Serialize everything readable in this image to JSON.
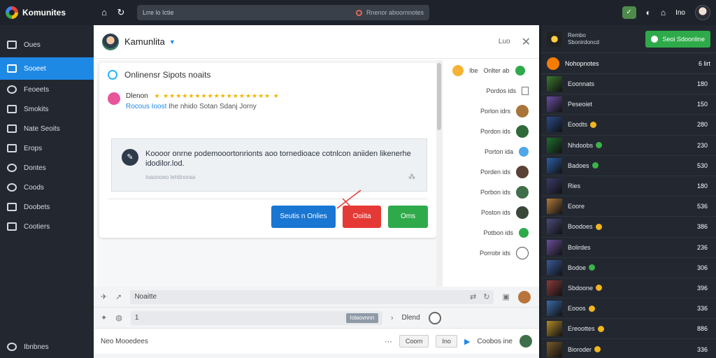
{
  "topbar": {
    "brand": "Komunites",
    "back_icon": "home-icon",
    "address_left": "Lrre lo Ictie",
    "address_right": "Rnenor aboornnotes",
    "right_text": "Ino"
  },
  "sidebar": {
    "items": [
      {
        "label": "Oues",
        "icon": "home-icon"
      },
      {
        "label": "Sooeet",
        "icon": "folder-icon"
      },
      {
        "label": "Feoeets",
        "icon": "community-icon"
      },
      {
        "label": "Smokits",
        "icon": "mail-icon"
      },
      {
        "label": "Nate Seoits",
        "icon": "screen-icon"
      },
      {
        "label": "Erops",
        "icon": "grid-icon"
      },
      {
        "label": "Dontes",
        "icon": "chat-icon"
      },
      {
        "label": "Coods",
        "icon": "user-icon"
      },
      {
        "label": "Doobets",
        "icon": "people-icon"
      },
      {
        "label": "Cootiers",
        "icon": "list-icon"
      }
    ],
    "bottom": "Ibnbnes"
  },
  "dialog": {
    "title": "Kamunlita",
    "header_right": "Luo",
    "card_title": "Onlinensr Sipots noaits",
    "reviewer": "Dlenon",
    "sub_line_hl": "Rocous Ioost",
    "sub_line_rest": "Ihe nhido Sotan Sdanj Jorny",
    "quote": "Koooor onrne podemooortonrionts aoo tornedioace cotnlcon aniiden likenerhe idodilor.lod.",
    "quote_sub": "Ioaonoeo lehttnoraa",
    "btn_blue": "Seutis n Onlies",
    "btn_red": "Ooiita",
    "btn_green": "Oms"
  },
  "right_list": {
    "first": "Onlter ab",
    "first_prefix": "Ibe",
    "items": [
      "Pordos ids",
      "Porlon idrs",
      "Pordon ids",
      "Porton ida",
      "Porden ids",
      "Porbon ids",
      "Poston ids",
      "Potbon ids",
      "Porrobr ids"
    ]
  },
  "bottom": {
    "row1": "Noaitte",
    "row2_num": "1",
    "row2_pill": "Iolaovnnn",
    "row2_right": "Dlend",
    "row3_left": "Neo Mooedees",
    "row3_pill1": "Coorn",
    "row3_pill2": "Ino",
    "row3_right": "Coobos ine"
  },
  "right_panel": {
    "head_line1": "Rembo",
    "head_line2": "Sbonirdoncd",
    "send_btn": "Seoi Sdoonline",
    "sub_left": "Nohopnotes",
    "sub_right": "6 lirt",
    "rows": [
      {
        "name": "Eoonnats",
        "val": "180",
        "coin": ""
      },
      {
        "name": "Peseoiet",
        "val": "150",
        "coin": ""
      },
      {
        "name": "Eoodts",
        "val": "280",
        "coin": "gold"
      },
      {
        "name": "Nhdoobs",
        "val": "230",
        "coin": "green"
      },
      {
        "name": "Badoes",
        "val": "530",
        "coin": "green"
      },
      {
        "name": "Ries",
        "val": "180",
        "coin": ""
      },
      {
        "name": "Eoore",
        "val": "536",
        "coin": ""
      },
      {
        "name": "Boodoes",
        "val": "386",
        "coin": "gold"
      },
      {
        "name": "Bolirdes",
        "val": "236",
        "coin": ""
      },
      {
        "name": "Bodoe",
        "val": "306",
        "coin": "green"
      },
      {
        "name": "Sbdoone",
        "val": "396",
        "coin": "gold"
      },
      {
        "name": "Eooos",
        "val": "336",
        "coin": "gold"
      },
      {
        "name": "Ereoottes",
        "val": "886",
        "coin": "gold"
      },
      {
        "name": "Bioroder",
        "val": "336",
        "coin": "gold"
      }
    ]
  },
  "colors": {
    "accent": "#1e88e5",
    "sidebar_bg": "#232830",
    "danger": "#e53935",
    "success": "#2eaa4a"
  }
}
